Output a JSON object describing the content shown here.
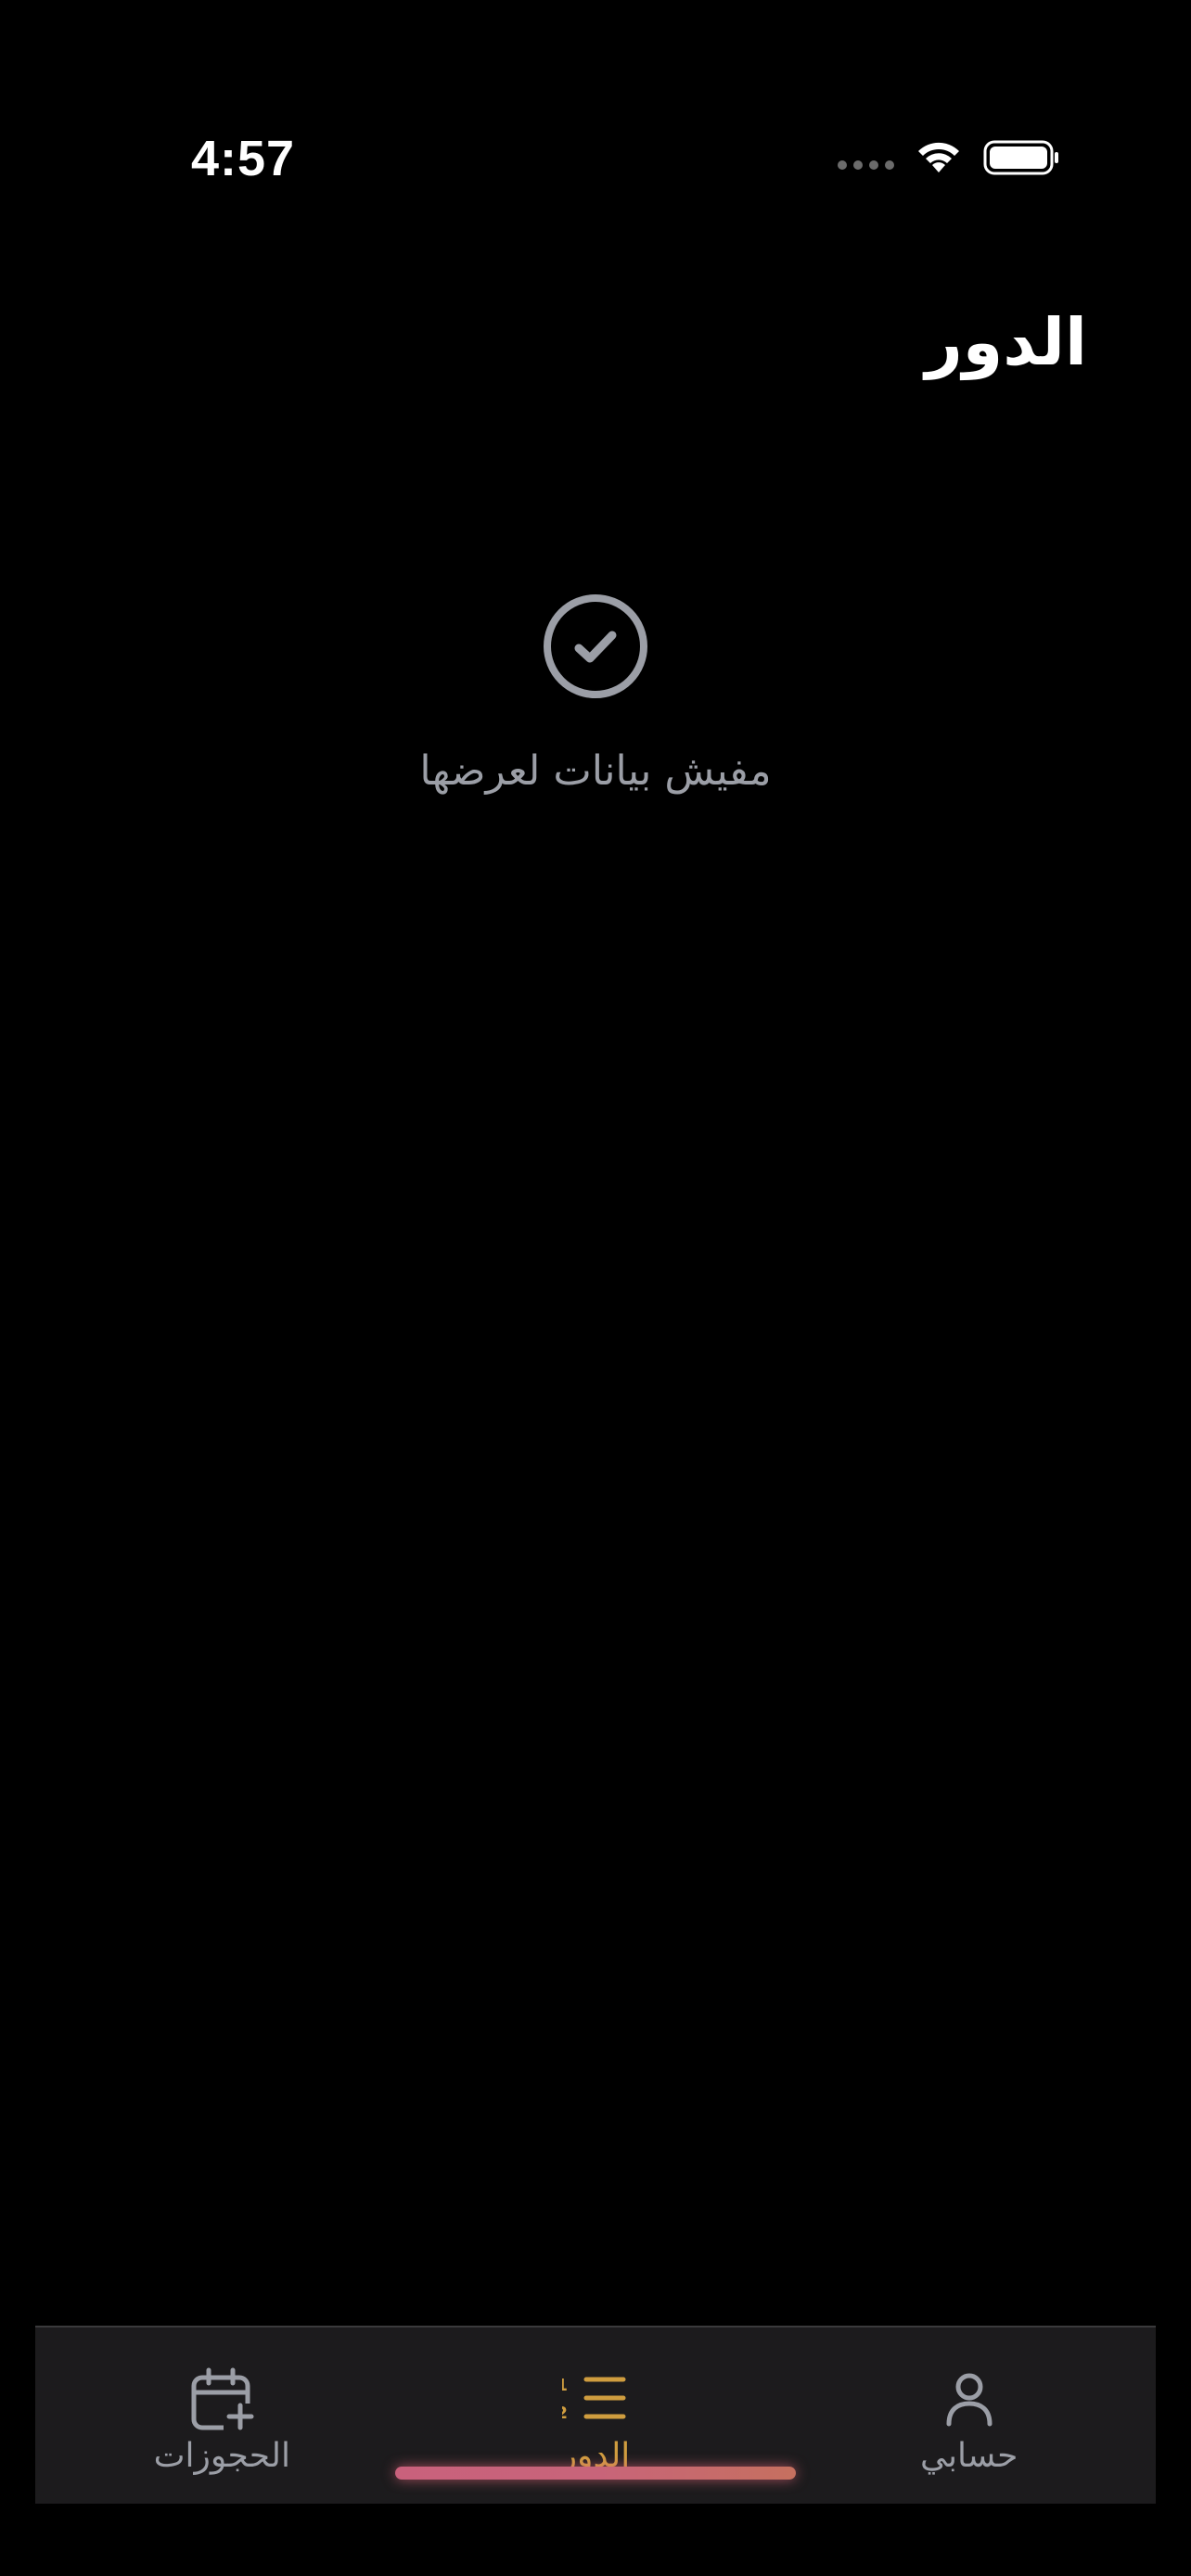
{
  "status_bar": {
    "time": "4:57",
    "icons": [
      "cellular-signal-icon",
      "wifi-icon",
      "battery-icon"
    ]
  },
  "header": {
    "title": "الدور"
  },
  "empty_state": {
    "icon": "check-circle-icon",
    "message": "مفيش بيانات لعرضها"
  },
  "tab_bar": {
    "tabs": [
      {
        "label": "حسابي",
        "icon": "person-icon",
        "active": false
      },
      {
        "label": "الدور",
        "icon": "numbered-list-icon",
        "active": true
      },
      {
        "label": "الحجوزات",
        "icon": "calendar-add-icon",
        "active": false
      }
    ]
  },
  "colors": {
    "background": "#000000",
    "tab_bar_background": "#1c1b1d",
    "inactive": "#9b9ea6",
    "accent": "#cf9d3f",
    "home_indicator": "#c9617c"
  }
}
